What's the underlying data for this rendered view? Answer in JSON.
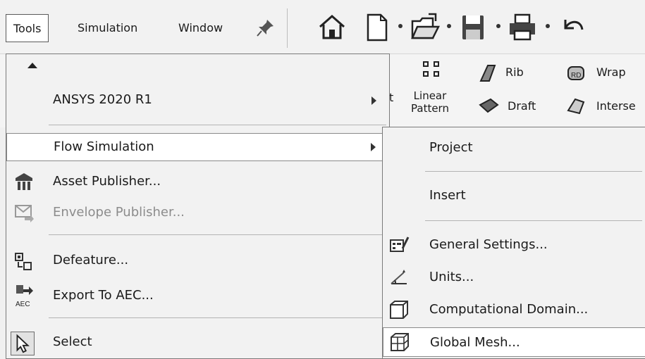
{
  "menubar": {
    "items": [
      "Tools",
      "Simulation",
      "Window"
    ]
  },
  "toolbar": {
    "icons": [
      "pin-icon",
      "home-icon",
      "new-document-icon",
      "open-folder-icon",
      "save-icon",
      "print-icon",
      "undo-icon"
    ]
  },
  "ribbon": {
    "linear_pattern": "Linear Pattern",
    "linear_pattern_line1": "Linear",
    "linear_pattern_line2": "Pattern",
    "rib": "Rib",
    "wrap": "Wrap",
    "draft": "Draft",
    "intersect": "Interse",
    "partial_t": "t"
  },
  "tools_menu": {
    "items": [
      {
        "label": "ANSYS 2020 R1",
        "submenu": true
      },
      {
        "label": "Flow Simulation",
        "submenu": true,
        "highlighted": true
      },
      {
        "label": "Asset Publisher...",
        "icon": "asset-publisher-icon"
      },
      {
        "label": "Envelope Publisher...",
        "icon": "envelope-publisher-icon",
        "disabled": true
      },
      {
        "label": "Defeature...",
        "icon": "defeature-icon"
      },
      {
        "label": "Export To AEC...",
        "icon": "export-aec-icon"
      },
      {
        "label": "Select",
        "icon": "select-cursor-icon"
      }
    ],
    "aec_text": "AEC"
  },
  "flow_submenu": {
    "items": [
      {
        "label": "Project"
      },
      {
        "label": "Insert"
      },
      {
        "label": "General Settings...",
        "icon": "general-settings-icon"
      },
      {
        "label": "Units...",
        "icon": "units-icon"
      },
      {
        "label": "Computational Domain...",
        "icon": "computational-domain-icon"
      },
      {
        "label": "Global Mesh...",
        "icon": "global-mesh-icon",
        "highlighted": true
      }
    ]
  }
}
